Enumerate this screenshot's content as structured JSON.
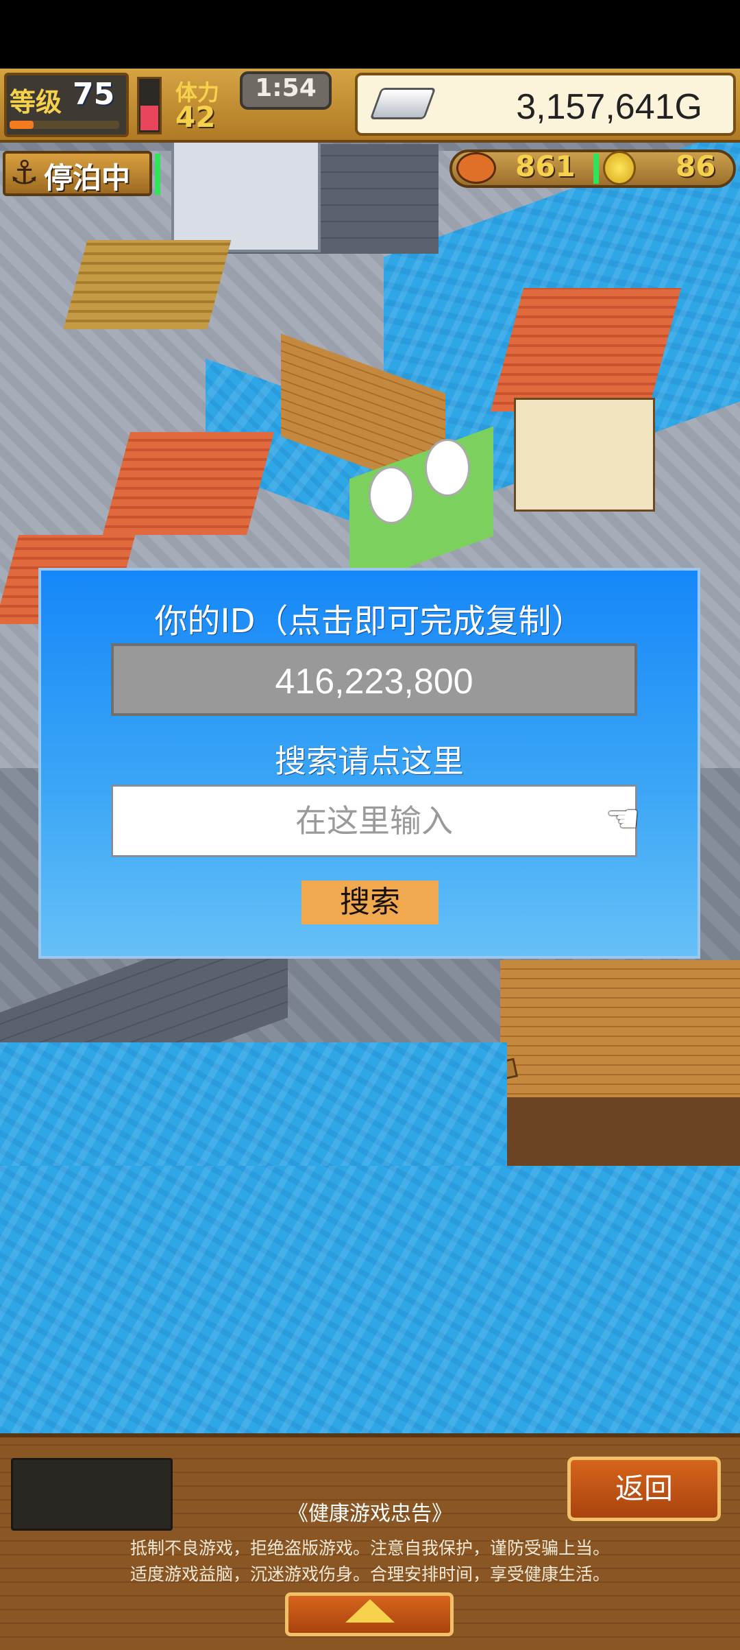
{
  "hud": {
    "level_label": "等级",
    "level": "75",
    "level_progress": 0.22,
    "stamina_label": "体力",
    "stamina": "42",
    "stamina_level": 0.5,
    "timer": "1:54",
    "gold": "3,157,641G",
    "docked_status": "停泊中",
    "food": "861",
    "medals": "86"
  },
  "dialog": {
    "title": "你的ID（点击即可完成复制）",
    "player_id": "416,223,800",
    "search_hint": "搜索请点这里",
    "search_placeholder": "在这里输入",
    "search_value": "",
    "search_button": "搜索"
  },
  "bottom": {
    "back_button": "返回",
    "advisory_title": "《健康游戏忠告》",
    "advisory_line1": "抵制不良游戏，拒绝盗版游戏。注意自我保护，谨防受骗上当。",
    "advisory_line2": "适度游戏益脑，沉迷游戏伤身。合理安排时间，享受健康生活。"
  },
  "icons": {
    "gold": "silver-bar-icon",
    "food": "meat-icon",
    "medal": "medal-icon",
    "anchor": "anchor-icon",
    "pointer": "pointing-hand-icon",
    "expand": "up-arrow-icon"
  }
}
